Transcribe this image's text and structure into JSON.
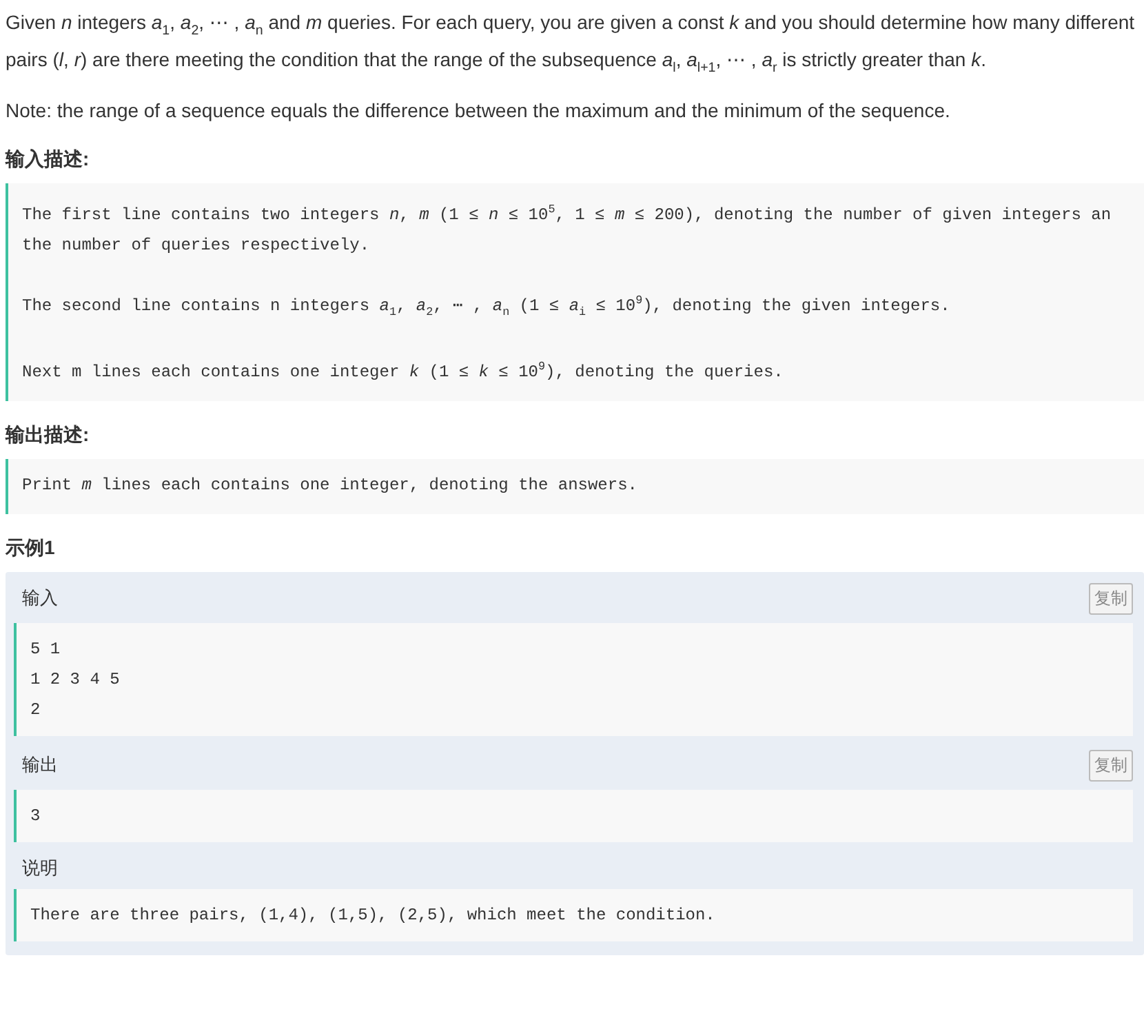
{
  "problem": {
    "paragraphs": [
      "Given *n* integers *a*$_{1}$, *a*$_{2}$, ⋯ , *a*$_{n}$ and *m* queries. For each query, you are given a const *k* and you should determine how many different pairs (*l*, *r*) are there meeting the condition that the range of the subsequence *a*$_{l}$, *a*$_{l+1}$, ⋯ , *a*$_{r}$ is strictly greater than *k*.",
      "Note: the range of a sequence equals the difference between the maximum and the minimum of the sequence."
    ]
  },
  "input_description": {
    "heading": "输入描述:",
    "paragraphs": [
      [
        "The first line contains two integers *n*, *m* (1 ≤ *n* ≤ 10$^{5}$, 1 ≤ *m* ≤ 200), denoting the number of given integers an",
        "the number of queries respectively."
      ],
      [
        "The second line contains n integers *a*$_{1}$, *a*$_{2}$, ⋯ , *a*$_{n}$ (1 ≤ *a*$_{i}$ ≤ 10$^{9}$), denoting the given integers."
      ],
      [
        "Next m lines each contains one integer *k* (1 ≤ *k* ≤ 10$^{9}$), denoting the queries."
      ]
    ]
  },
  "output_description": {
    "heading": "输出描述:",
    "paragraphs": [
      [
        "Print *m* lines each contains one integer, denoting the answers."
      ]
    ]
  },
  "example": {
    "heading": "示例1",
    "sections": [
      {
        "label": "输入",
        "copy_button": "复制",
        "lines": [
          "5 1",
          "1 2 3 4 5",
          "2"
        ]
      },
      {
        "label": "输出",
        "copy_button": "复制",
        "lines": [
          "3"
        ]
      },
      {
        "label": "说明",
        "lines": [
          "There are three pairs, (1,4), (1,5), (2,5), which meet the condition."
        ]
      }
    ]
  }
}
